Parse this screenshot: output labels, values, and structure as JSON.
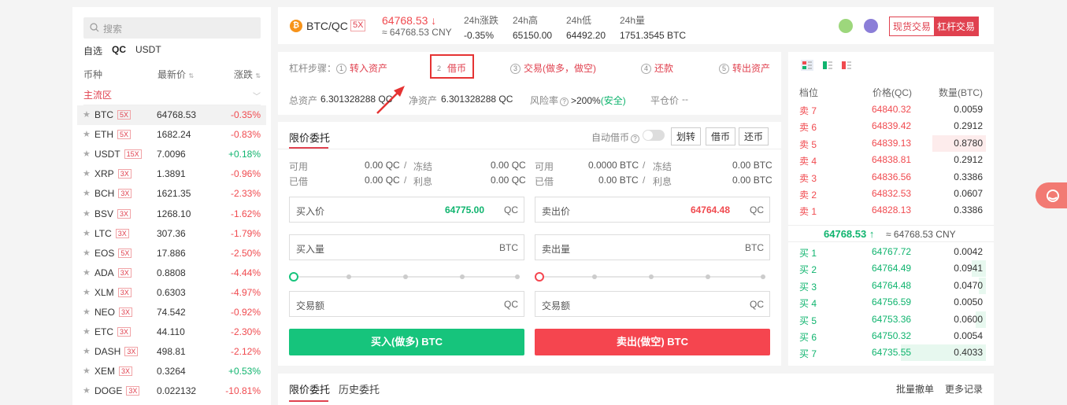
{
  "market": {
    "search_placeholder": "搜索",
    "tabs": [
      "自选",
      "QC",
      "USDT"
    ],
    "header": {
      "col1": "币种",
      "col2": "最新价",
      "col3": "涨跌"
    },
    "zone": "主流区",
    "rows": [
      {
        "sym": "BTC",
        "lev": "5X",
        "price": "64768.53",
        "chg": "-0.35%",
        "up": false
      },
      {
        "sym": "ETH",
        "lev": "5X",
        "price": "1682.24",
        "chg": "-0.83%",
        "up": false
      },
      {
        "sym": "USDT",
        "lev": "15X",
        "price": "7.0096",
        "chg": "+0.18%",
        "up": true
      },
      {
        "sym": "XRP",
        "lev": "3X",
        "price": "1.3891",
        "chg": "-0.96%",
        "up": false
      },
      {
        "sym": "BCH",
        "lev": "3X",
        "price": "1621.35",
        "chg": "-2.33%",
        "up": false
      },
      {
        "sym": "BSV",
        "lev": "3X",
        "price": "1268.10",
        "chg": "-1.62%",
        "up": false
      },
      {
        "sym": "LTC",
        "lev": "3X",
        "price": "307.36",
        "chg": "-1.79%",
        "up": false
      },
      {
        "sym": "EOS",
        "lev": "5X",
        "price": "17.886",
        "chg": "-2.50%",
        "up": false
      },
      {
        "sym": "ADA",
        "lev": "3X",
        "price": "0.8808",
        "chg": "-4.44%",
        "up": false
      },
      {
        "sym": "XLM",
        "lev": "3X",
        "price": "0.6303",
        "chg": "-4.97%",
        "up": false
      },
      {
        "sym": "NEO",
        "lev": "3X",
        "price": "74.542",
        "chg": "-0.92%",
        "up": false
      },
      {
        "sym": "ETC",
        "lev": "3X",
        "price": "44.110",
        "chg": "-2.30%",
        "up": false
      },
      {
        "sym": "DASH",
        "lev": "3X",
        "price": "498.81",
        "chg": "-2.12%",
        "up": false
      },
      {
        "sym": "XEM",
        "lev": "3X",
        "price": "0.3264",
        "chg": "+0.53%",
        "up": true
      },
      {
        "sym": "DOGE",
        "lev": "3X",
        "price": "0.022132",
        "chg": "-10.81%",
        "up": false
      }
    ]
  },
  "ticker": {
    "coin_letter": "₿",
    "pair": "BTC/QC",
    "leverage": "5X",
    "price": "64768.53 ↓",
    "cny": "≈ 64768.53 CNY",
    "stats": [
      {
        "label": "24h涨跌",
        "value": "-0.35%",
        "red": true
      },
      {
        "label": "24h高",
        "value": "65150.00",
        "red": false
      },
      {
        "label": "24h低",
        "value": "64492.20",
        "red": false
      },
      {
        "label": "24h量",
        "value": "1751.3545 BTC",
        "red": false
      }
    ],
    "spot_btn": "现货交易",
    "margin_btn": "杠杆交易"
  },
  "steps": {
    "label": "杠杆步骤：",
    "items": [
      {
        "n": "1",
        "text": "转入资产"
      },
      {
        "n": "2",
        "text": "借币"
      },
      {
        "n": "3",
        "text": "交易(做多，做空)"
      },
      {
        "n": "4",
        "text": "还款"
      },
      {
        "n": "5",
        "text": "转出资产"
      }
    ],
    "total_assets": "总资产",
    "total_assets_val": "6.301328288 QC",
    "net_assets": "净资产",
    "net_assets_val": "6.301328288 QC",
    "risk_label": "风险率",
    "risk_val": ">200%",
    "risk_status": "(安全)",
    "liq_label": "平仓价",
    "liq_val": "--"
  },
  "order": {
    "title": "限价委托",
    "auto_borrow": "自动借币",
    "btn_transfer": "划转",
    "btn_borrow": "借币",
    "btn_repay": "还币",
    "buy": {
      "avail_label": "可用",
      "avail_val": "0.00 QC",
      "frozen_label": "冻结",
      "frozen_val": "0.00 QC",
      "borrowed_label": "已借",
      "borrowed_val": "0.00 QC",
      "interest_label": "利息",
      "interest_val": "0.00 QC",
      "price_label": "买入价",
      "price_val": "64775.00",
      "price_unit": "QC",
      "amount_label": "买入量",
      "amount_unit": "BTC",
      "total_label": "交易额",
      "total_unit": "QC",
      "button": "买入(做多) BTC"
    },
    "sell": {
      "avail_label": "可用",
      "avail_val": "0.0000 BTC",
      "frozen_label": "冻结",
      "frozen_val": "0.00 BTC",
      "borrowed_label": "已借",
      "borrowed_val": "0.00 BTC",
      "interest_label": "利息",
      "interest_val": "0.00 BTC",
      "price_label": "卖出价",
      "price_val": "64764.48",
      "price_unit": "QC",
      "amount_label": "卖出量",
      "amount_unit": "BTC",
      "total_label": "交易额",
      "total_unit": "QC",
      "button": "卖出(做空) BTC"
    },
    "buy_color": "#16c47c",
    "sell_color": "#f5454f"
  },
  "bottom": {
    "tab1": "限价委托",
    "tab2": "历史委托",
    "batch_cancel": "批量撤单",
    "more": "更多记录"
  },
  "book": {
    "head": {
      "c1": "档位",
      "c2": "价格(QC)",
      "c3": "数量(BTC)"
    },
    "asks": [
      {
        "lbl": "卖 7",
        "p": "64840.32",
        "q": "0.0059",
        "depth": 0
      },
      {
        "lbl": "卖 6",
        "p": "64839.42",
        "q": "0.2912",
        "depth": 0
      },
      {
        "lbl": "卖 5",
        "p": "64839.13",
        "q": "0.8780",
        "depth": 0.38
      },
      {
        "lbl": "卖 4",
        "p": "64838.81",
        "q": "0.2912",
        "depth": 0
      },
      {
        "lbl": "卖 3",
        "p": "64836.56",
        "q": "0.3386",
        "depth": 0
      },
      {
        "lbl": "卖 2",
        "p": "64832.53",
        "q": "0.0607",
        "depth": 0
      },
      {
        "lbl": "卖 1",
        "p": "64828.13",
        "q": "0.3386",
        "depth": 0
      }
    ],
    "mid_price": "64768.53 ↑",
    "mid_cny": "≈ 64768.53 CNY",
    "bids": [
      {
        "lbl": "买 1",
        "p": "64767.72",
        "q": "0.0042",
        "depth": 0
      },
      {
        "lbl": "买 2",
        "p": "64764.49",
        "q": "0.0941",
        "depth": 0.1
      },
      {
        "lbl": "买 3",
        "p": "64764.48",
        "q": "0.0470",
        "depth": 0.05
      },
      {
        "lbl": "买 4",
        "p": "64756.59",
        "q": "0.0050",
        "depth": 0
      },
      {
        "lbl": "买 5",
        "p": "64753.36",
        "q": "0.0600",
        "depth": 0.07
      },
      {
        "lbl": "买 6",
        "p": "64750.32",
        "q": "0.0054",
        "depth": 0
      },
      {
        "lbl": "买 7",
        "p": "64735.55",
        "q": "0.4033",
        "depth": 0.6
      }
    ]
  }
}
